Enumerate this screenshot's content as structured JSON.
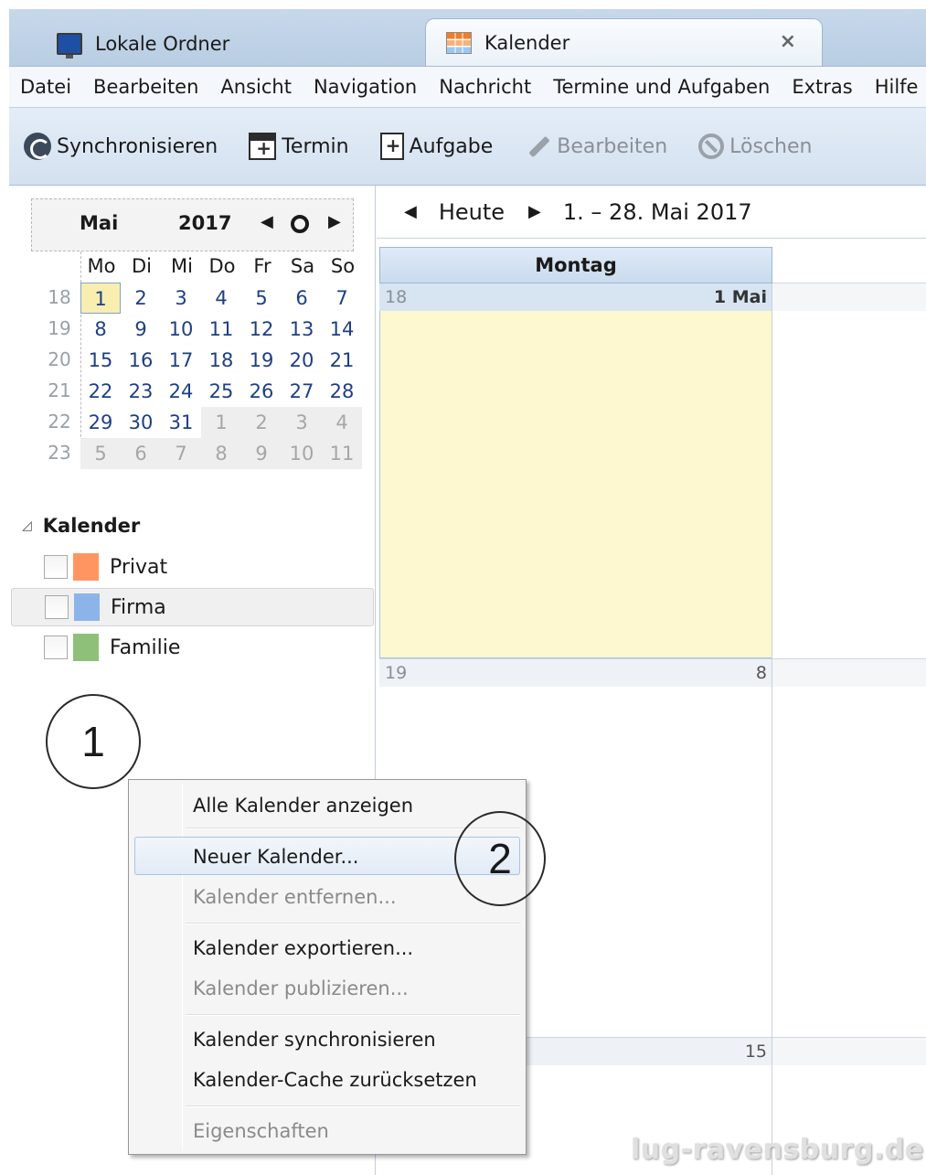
{
  "tabs": [
    {
      "label": "Lokale Ordner",
      "icon": "monitor-icon"
    },
    {
      "label": "Kalender",
      "icon": "calendar-tab-icon",
      "active": true
    }
  ],
  "tab_close": "×",
  "menu": [
    "Datei",
    "Bearbeiten",
    "Ansicht",
    "Navigation",
    "Nachricht",
    "Termine und Aufgaben",
    "Extras",
    "Hilfe"
  ],
  "toolbar": {
    "sync": "Synchronisieren",
    "event": "Termin",
    "task": "Aufgabe",
    "edit": "Bearbeiten",
    "delete": "Löschen"
  },
  "minimonth": {
    "month": "Mai",
    "year": "2017",
    "prev": "◀",
    "next": "▶",
    "day_headers": [
      "Mo",
      "Di",
      "Mi",
      "Do",
      "Fr",
      "Sa",
      "So"
    ],
    "weeks": [
      {
        "wk": "18",
        "days": [
          "1",
          "2",
          "3",
          "4",
          "5",
          "6",
          "7"
        ]
      },
      {
        "wk": "19",
        "days": [
          "8",
          "9",
          "10",
          "11",
          "12",
          "13",
          "14"
        ]
      },
      {
        "wk": "20",
        "days": [
          "15",
          "16",
          "17",
          "18",
          "19",
          "20",
          "21"
        ]
      },
      {
        "wk": "21",
        "days": [
          "22",
          "23",
          "24",
          "25",
          "26",
          "27",
          "28"
        ]
      },
      {
        "wk": "22",
        "days": [
          "29",
          "30",
          "31",
          "1",
          "2",
          "3",
          "4"
        ]
      },
      {
        "wk": "23",
        "days": [
          "5",
          "6",
          "7",
          "8",
          "9",
          "10",
          "11"
        ]
      }
    ]
  },
  "calendars": {
    "header": "Kalender",
    "items": [
      {
        "name": "Privat",
        "color": "#ff9661"
      },
      {
        "name": "Firma",
        "color": "#8db4e8"
      },
      {
        "name": "Familie",
        "color": "#8fc07a"
      }
    ]
  },
  "annotations": {
    "one": "1",
    "two": "2"
  },
  "calnav": {
    "prev": "◀",
    "today": "Heute",
    "next": "▶",
    "range": "1. – 28. Mai 2017"
  },
  "dayview": {
    "day_header": "Montag",
    "rows": [
      {
        "wk": "18",
        "day": "1 Mai"
      },
      {
        "wk": "19",
        "day": "8"
      },
      {
        "wk": "",
        "day": "15"
      }
    ]
  },
  "context_menu": {
    "items": [
      {
        "label": "Alle Kalender anzeigen",
        "enabled": true
      },
      {
        "label": "Neuer Kalender...",
        "enabled": true,
        "highlighted": true
      },
      {
        "label": "Kalender entfernen...",
        "enabled": false
      },
      {
        "label": "Kalender exportieren...",
        "enabled": true
      },
      {
        "label": "Kalender publizieren...",
        "enabled": false
      },
      {
        "label": "Kalender synchronisieren",
        "enabled": true
      },
      {
        "label": "Kalender-Cache zurücksetzen",
        "enabled": true
      },
      {
        "label": "Eigenschaften",
        "enabled": false
      }
    ]
  },
  "watermark": "lug-ravensburg.de"
}
